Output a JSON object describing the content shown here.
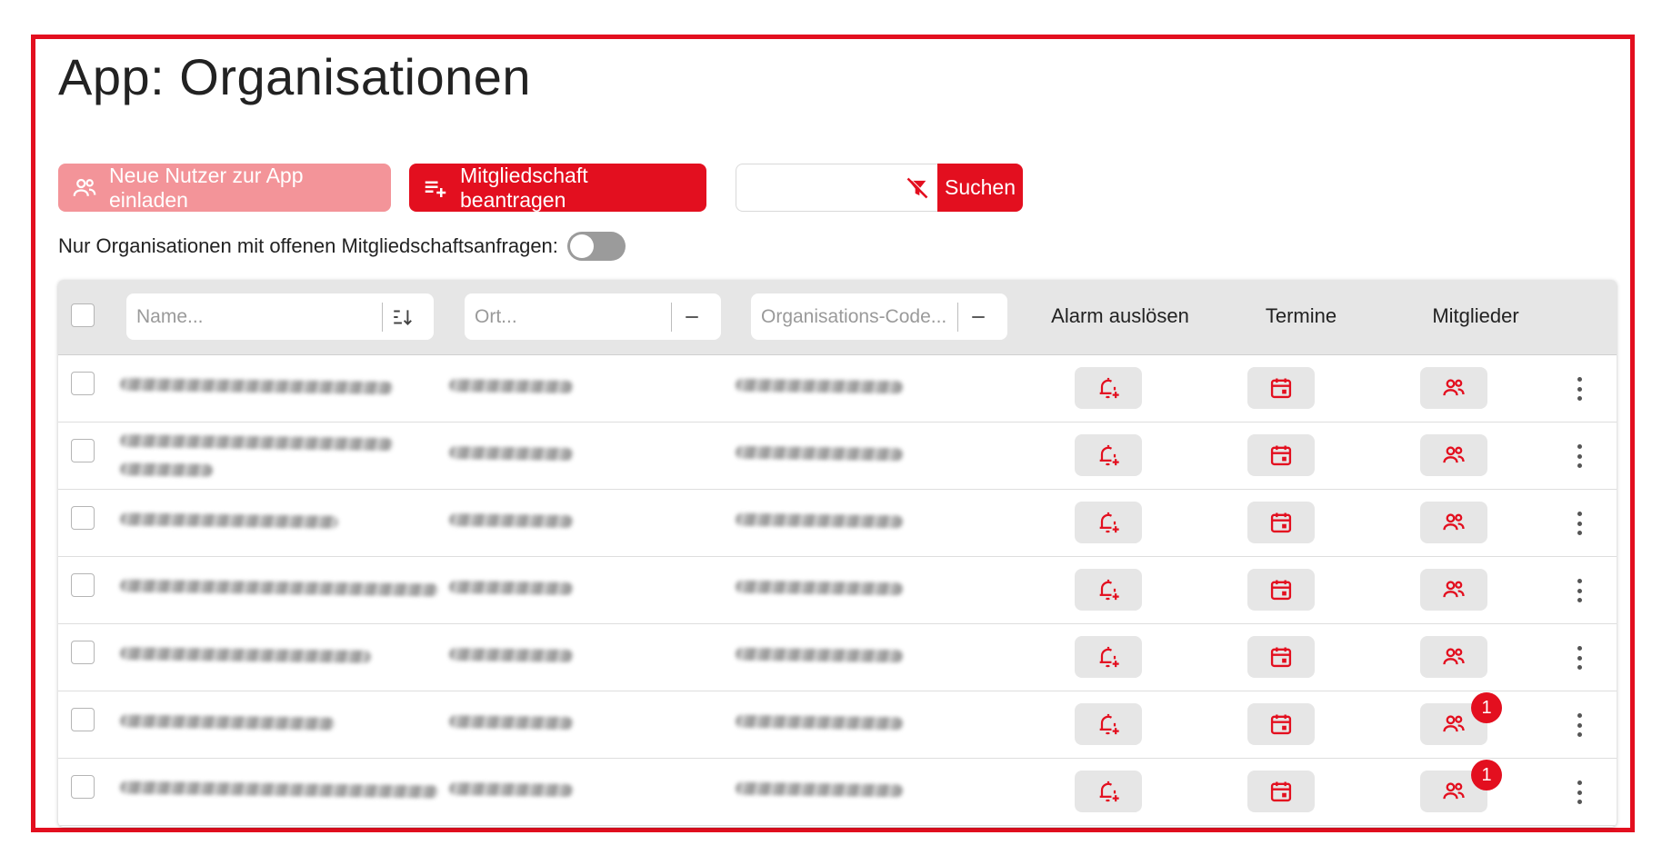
{
  "page": {
    "title": "App: Organisationen"
  },
  "toolbar": {
    "invite_label": "Neue Nutzer zur App einladen",
    "membership_label": "Mitgliedschaft beantragen",
    "search_value": "",
    "search_label": "Suchen"
  },
  "filter_toggle": {
    "label": "Nur Organisationen mit offenen Mitgliedschaftsanfragen:",
    "on": false
  },
  "table": {
    "name_placeholder": "Name...",
    "ort_placeholder": "Ort...",
    "code_placeholder": "Organisations-Code...",
    "col_alarm": "Alarm auslösen",
    "col_termine": "Termine",
    "col_mitglieder": "Mitglieder",
    "rows": [
      {
        "badge": ""
      },
      {
        "badge": ""
      },
      {
        "badge": ""
      },
      {
        "badge": ""
      },
      {
        "badge": ""
      },
      {
        "badge": "1"
      },
      {
        "badge": "1"
      }
    ]
  },
  "colors": {
    "accent": "#e30f1f",
    "accent_light": "#f39499",
    "header_bg": "#e6e6e6"
  },
  "icons": {
    "invite": "user-group-icon",
    "membership": "playlist-add-icon",
    "search_clear": "filter-off-icon",
    "alarm": "bell-plus-icon",
    "termine": "calendar-icon",
    "mitglieder": "user-group-icon",
    "more": "more-vertical-icon"
  }
}
